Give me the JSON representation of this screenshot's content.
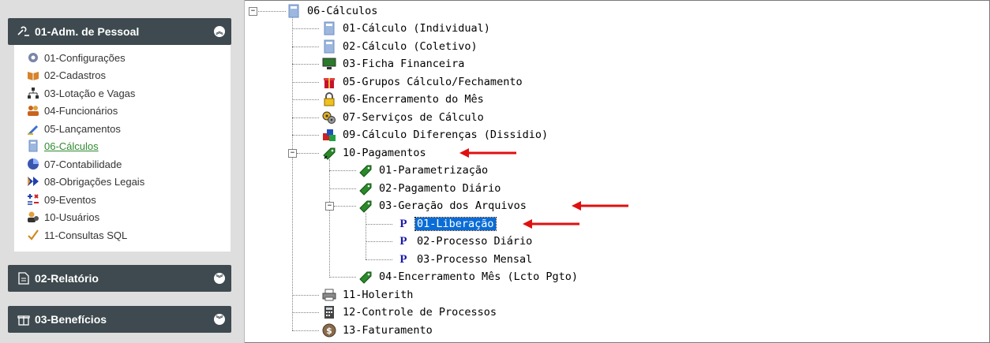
{
  "sidebar": {
    "section1": {
      "title": "01-Adm. de Pessoal",
      "icon": "gear-wrench-icon"
    },
    "items": [
      {
        "label": "01-Configurações",
        "icon": "gear-icon",
        "color": "#7a86a8"
      },
      {
        "label": "02-Cadastros",
        "icon": "book-icon",
        "color": "#d6832b"
      },
      {
        "label": "03-Lotação e Vagas",
        "icon": "org-chart-icon",
        "color": "#333333"
      },
      {
        "label": "04-Funcionários",
        "icon": "people-icon",
        "color": "#c9641e"
      },
      {
        "label": "05-Lançamentos",
        "icon": "pencil-icon",
        "color": "#3a6fd0"
      },
      {
        "label": "06-Cálculos",
        "icon": "calculator-icon",
        "color": "#7fa0d0",
        "active": true
      },
      {
        "label": "07-Contabilidade",
        "icon": "pie-chart-icon",
        "color": "#3a57b0"
      },
      {
        "label": "08-Obrigações Legais",
        "icon": "double-arrow-icon",
        "color": "#1f3fb0"
      },
      {
        "label": "09-Eventos",
        "icon": "plus-minus-icon",
        "color": "#d02020"
      },
      {
        "label": "10-Usuários",
        "icon": "users-icon",
        "color": "#333333"
      },
      {
        "label": "11-Consultas SQL",
        "icon": "check-icon",
        "color": "#d08a20"
      }
    ],
    "section2": {
      "title": "02-Relatório",
      "icon": "document-icon"
    },
    "section3": {
      "title": "03-Benefícios",
      "icon": "gift-icon"
    }
  },
  "tree": {
    "root": {
      "label": "06-Cálculos",
      "icon": "calculator-icon"
    },
    "level1": [
      {
        "label": "01-Cálculo (Individual)",
        "icon": "calculator-icon"
      },
      {
        "label": "02-Cálculo (Coletivo)",
        "icon": "calculator-icon"
      },
      {
        "label": "03-Ficha Financeira",
        "icon": "monitor-icon"
      },
      {
        "label": "05-Grupos Cálculo/Fechamento",
        "icon": "gift-icon"
      },
      {
        "label": "06-Encerramento do Mês",
        "icon": "lock-icon"
      },
      {
        "label": "07-Serviços de Cálculo",
        "icon": "gears-icon"
      },
      {
        "label": "09-Cálculo Diferenças (Dissidio)",
        "icon": "cubes-icon"
      },
      {
        "label": "10-Pagamentos",
        "icon": "money-tag-icon"
      },
      {
        "label": "11-Holerith",
        "icon": "printer-icon"
      },
      {
        "label": "12-Controle de Processos",
        "icon": "calculator-dark-icon"
      },
      {
        "label": "13-Faturamento",
        "icon": "dollar-coin-icon"
      }
    ],
    "pagamentos": [
      {
        "label": "01-Parametrização",
        "icon": "money-tag-icon"
      },
      {
        "label": "02-Pagamento Diário",
        "icon": "money-tag-icon"
      },
      {
        "label": "03-Geração dos Arquivos",
        "icon": "money-tag-icon"
      },
      {
        "label": "04-Encerramento Mês (Lcto Pgto)",
        "icon": "money-tag-icon"
      }
    ],
    "geracao": [
      {
        "label": "01-Liberação",
        "icon": "p",
        "selected": true
      },
      {
        "label": "02-Processo Diário",
        "icon": "p"
      },
      {
        "label": "03-Processo Mensal",
        "icon": "p"
      }
    ],
    "expander_minus": "−"
  },
  "annotation_color": "#e01010"
}
